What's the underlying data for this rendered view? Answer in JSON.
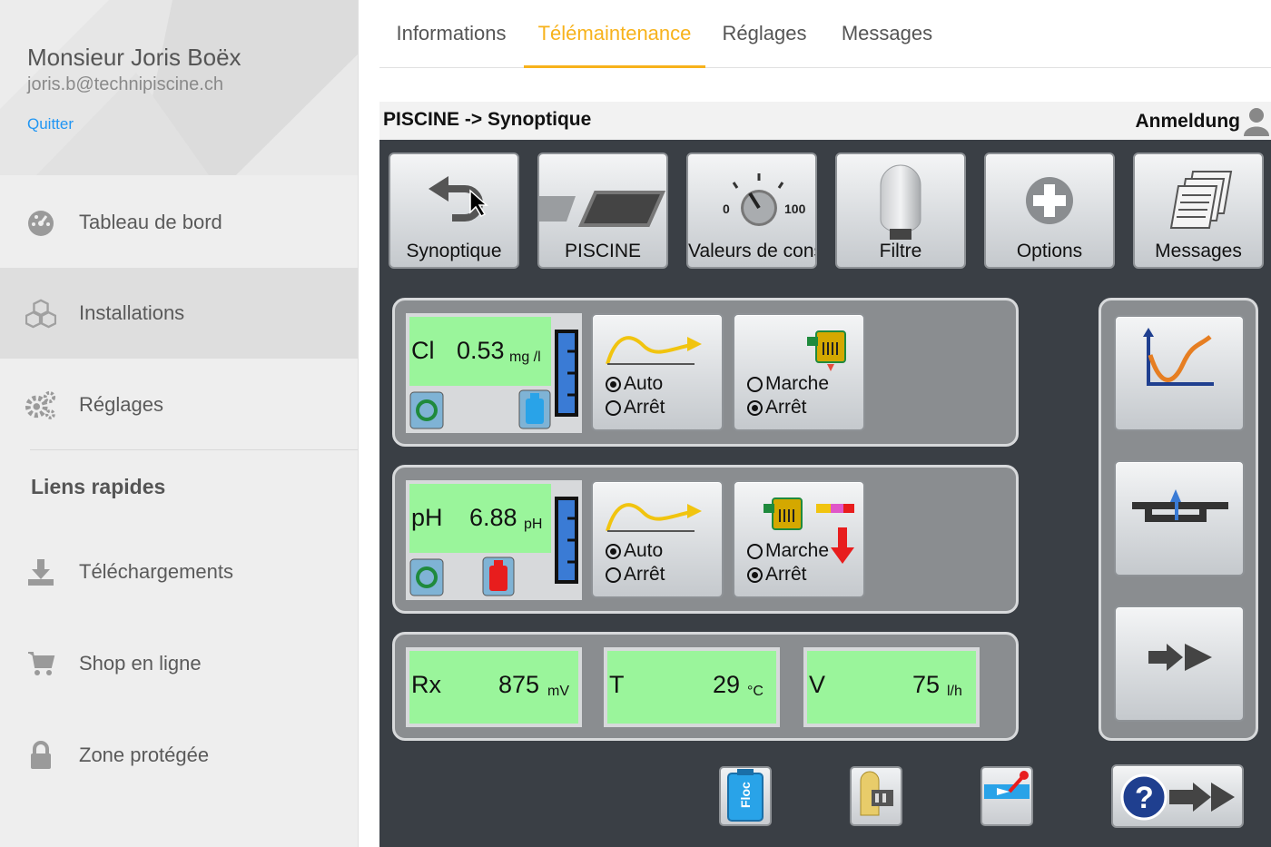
{
  "profile": {
    "name": "Monsieur Joris Boëx",
    "email": "joris.b@technipiscine.ch",
    "quit_label": "Quitter"
  },
  "sidebar": {
    "items": [
      {
        "label": "Tableau de bord",
        "icon": "dashboard-icon"
      },
      {
        "label": "Installations",
        "icon": "cubes-icon"
      },
      {
        "label": "Réglages",
        "icon": "gears-icon"
      }
    ],
    "quick_links_title": "Liens rapides",
    "quick_links": [
      {
        "label": "Téléchargements",
        "icon": "download-icon"
      },
      {
        "label": "Shop en ligne",
        "icon": "cart-icon"
      },
      {
        "label": "Zone protégée",
        "icon": "lock-icon"
      }
    ]
  },
  "tabs": [
    "Informations",
    "Télémaintenance",
    "Réglages",
    "Messages"
  ],
  "active_tab": "Télémaintenance",
  "colors": {
    "accent": "#f7b21b",
    "link": "#2196f3",
    "measure_green": "#9af59b"
  },
  "hmi": {
    "path": "PISCINE -> Synoptique",
    "login": "Anmeldung",
    "top_buttons": [
      {
        "label": "Synoptique",
        "icon": "back-arrow-icon"
      },
      {
        "label": "PISCINE",
        "icon": "pool-icon"
      },
      {
        "label": "Valeurs de consigne",
        "icon": "dial-icon",
        "dial_min": "0",
        "dial_max": "100"
      },
      {
        "label": "Filtre",
        "icon": "filter-icon"
      },
      {
        "label": "Options",
        "icon": "plus-icon"
      },
      {
        "label": "Messages",
        "icon": "documents-icon"
      }
    ],
    "cl": {
      "name": "Cl",
      "value": "0.53",
      "unit": "mg /l"
    },
    "ph": {
      "name": "pH",
      "value": "6.88",
      "unit": "pH"
    },
    "auto_label": "Auto",
    "stop_label": "Arrêt",
    "run_label": "Marche",
    "rx": {
      "name": "Rx",
      "value": "875",
      "unit": "mV"
    },
    "temp": {
      "name": "T",
      "value": "29",
      "unit": "°C"
    },
    "flow": {
      "name": "V",
      "value": "75",
      "unit": "l/h"
    },
    "bottom_icons": [
      {
        "label": "Floc",
        "icon": "floc-canister-icon"
      },
      {
        "icon": "pump-icon"
      },
      {
        "icon": "injection-icon"
      }
    ]
  }
}
